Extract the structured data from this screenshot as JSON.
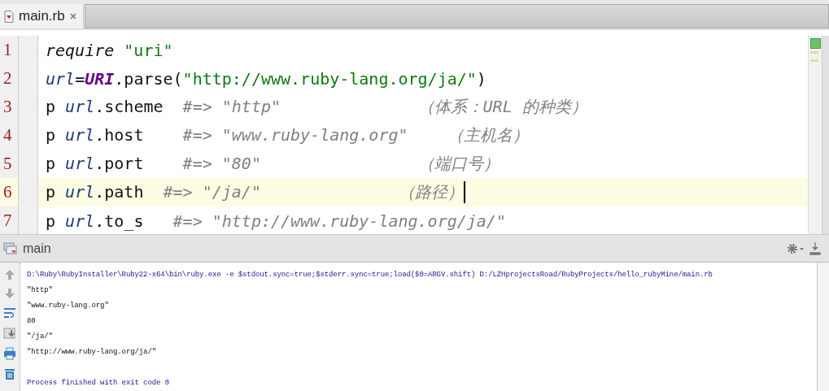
{
  "editor_tabs": [
    {
      "label": "main.rb",
      "selected": true
    }
  ],
  "editor": {
    "lines": [
      {
        "number": "1",
        "current": false,
        "tokens": [
          {
            "kind": "keyword",
            "text": "require "
          },
          {
            "kind": "string",
            "text": "\"uri\""
          }
        ]
      },
      {
        "number": "2",
        "current": false,
        "tokens": [
          {
            "kind": "var",
            "text": "url"
          },
          {
            "kind": "plain",
            "text": "="
          },
          {
            "kind": "const",
            "text": "URI"
          },
          {
            "kind": "plain",
            "text": ".parse("
          },
          {
            "kind": "string",
            "text": "\"http://www.ruby-lang.org/ja/\""
          },
          {
            "kind": "plain",
            "text": ")"
          }
        ]
      },
      {
        "number": "3",
        "current": false,
        "tokens": [
          {
            "kind": "plain",
            "text": "p "
          },
          {
            "kind": "var",
            "text": "url"
          },
          {
            "kind": "plain",
            "text": ".scheme  "
          },
          {
            "kind": "comment",
            "text": "#=> \"http\"              （体系：URL 的种类）"
          }
        ]
      },
      {
        "number": "4",
        "current": false,
        "tokens": [
          {
            "kind": "plain",
            "text": "p "
          },
          {
            "kind": "var",
            "text": "url"
          },
          {
            "kind": "plain",
            "text": ".host    "
          },
          {
            "kind": "comment",
            "text": "#=> \"www.ruby-lang.org\"    （主机名）"
          }
        ]
      },
      {
        "number": "5",
        "current": false,
        "tokens": [
          {
            "kind": "plain",
            "text": "p "
          },
          {
            "kind": "var",
            "text": "url"
          },
          {
            "kind": "plain",
            "text": ".port    "
          },
          {
            "kind": "comment",
            "text": "#=> \"80\"                （端口号）"
          }
        ]
      },
      {
        "number": "6",
        "current": true,
        "tokens": [
          {
            "kind": "plain",
            "text": "p "
          },
          {
            "kind": "var",
            "text": "url"
          },
          {
            "kind": "plain",
            "text": ".path  "
          },
          {
            "kind": "comment",
            "text": "#=> \"/ja/\"              （路径）"
          }
        ]
      },
      {
        "number": "7",
        "current": false,
        "tokens": [
          {
            "kind": "plain",
            "text": "p "
          },
          {
            "kind": "var",
            "text": "url"
          },
          {
            "kind": "plain",
            "text": ".to_s   "
          },
          {
            "kind": "comment",
            "text": "#=> \"http://www.ruby-lang.org/ja/\""
          }
        ]
      }
    ]
  },
  "run_panel": {
    "title": "main",
    "console": [
      {
        "kind": "command",
        "text": "D:\\Ruby\\RubyInstaller\\Ruby22-x64\\bin\\ruby.exe -e $stdout.sync=true;$stderr.sync=true;load($0=ARGV.shift) D:/LZHprojectsRoad/RubyProjects/hello_rubyMine/main.rb"
      },
      {
        "kind": "output",
        "text": "\"http\""
      },
      {
        "kind": "output",
        "text": "\"www.ruby-lang.org\""
      },
      {
        "kind": "output",
        "text": "80"
      },
      {
        "kind": "output",
        "text": "\"/ja/\""
      },
      {
        "kind": "output",
        "text": "\"http://www.ruby-lang.org/ja/\""
      },
      {
        "kind": "blank"
      },
      {
        "kind": "system",
        "text": "Process finished with exit code 0"
      }
    ]
  }
}
